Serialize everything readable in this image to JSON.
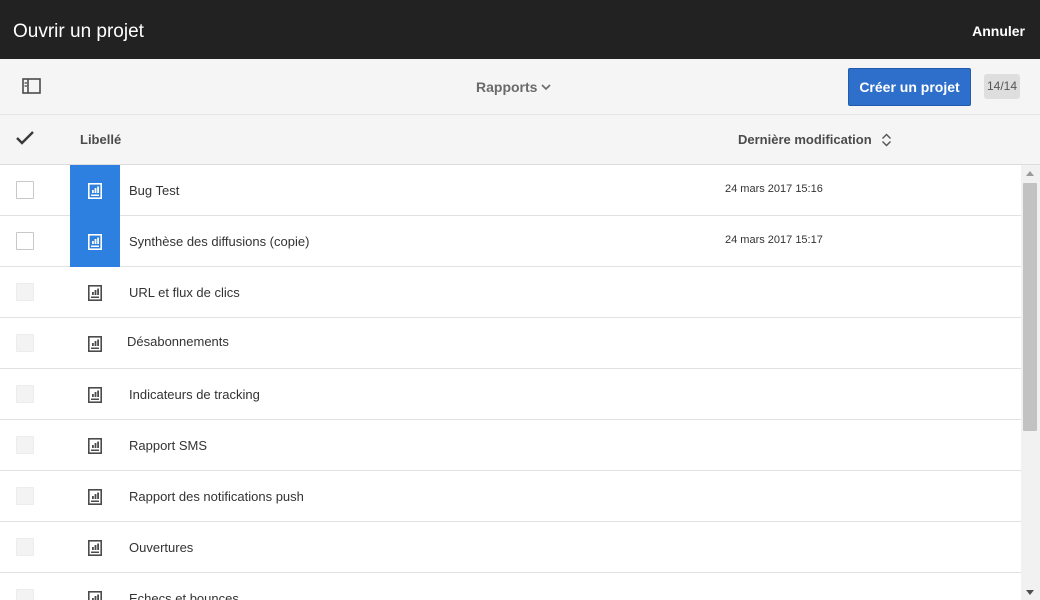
{
  "topbar": {
    "title": "Ouvrir un projet",
    "cancel_label": "Annuler"
  },
  "toolbar": {
    "dropdown_label": "Rapports",
    "create_label": "Créer un projet",
    "count": "14/14"
  },
  "table": {
    "col_label": "Libellé",
    "col_date": "Dernière modification",
    "rows": [
      {
        "name": "Bug Test",
        "date": "24 mars 2017 15:16"
      },
      {
        "name": "Synthèse des diffusions (copie)",
        "date": "24 mars 2017 15:17"
      },
      {
        "name": "URL et flux de clics",
        "date": ""
      },
      {
        "name": "Désabonnements",
        "date": ""
      },
      {
        "name": "Indicateurs de tracking",
        "date": ""
      },
      {
        "name": "Rapport SMS",
        "date": ""
      },
      {
        "name": "Rapport des notifications push",
        "date": ""
      },
      {
        "name": "Ouvertures",
        "date": ""
      },
      {
        "name": "Echecs et bounces",
        "date": ""
      }
    ]
  },
  "colors": {
    "topbar": "#222222",
    "accent": "#2d6fca",
    "active_thumb": "#2d7fe0"
  }
}
